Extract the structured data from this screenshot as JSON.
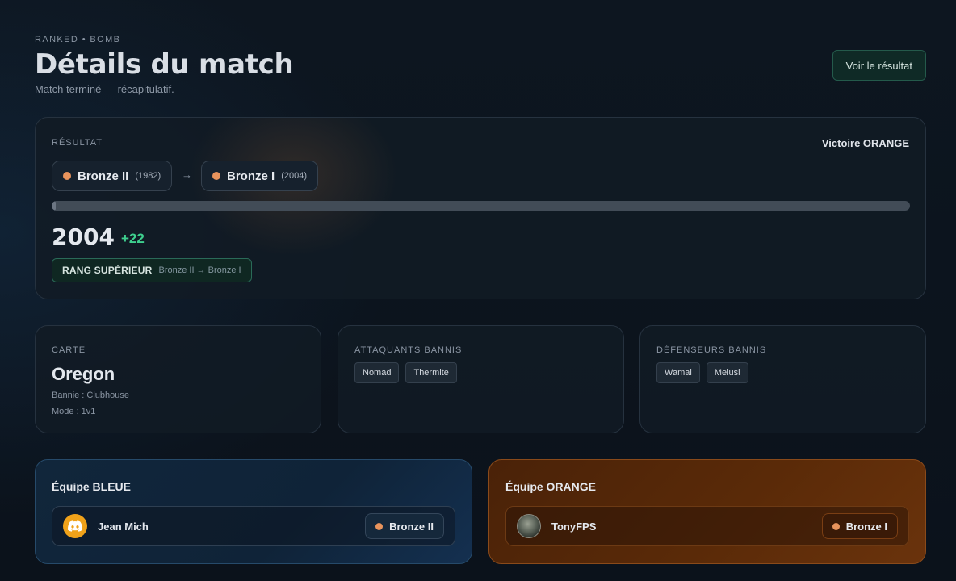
{
  "header": {
    "eyebrow": "RANKED • BOMB",
    "title": "Détails du match",
    "subtitle": "Match terminé — récapitulatif.",
    "result_button": "Voir le résultat"
  },
  "result": {
    "label": "RÉSULTAT",
    "outcome": "Victoire ORANGE",
    "from_rank": {
      "name": "Bronze II",
      "elo": "(1982)"
    },
    "arrow": "→",
    "to_rank": {
      "name": "Bronze I",
      "elo": "(2004)"
    },
    "progress_fraction": 0.005,
    "score": "2004",
    "delta": "+22",
    "promotion": {
      "title": "RANG SUPÉRIEUR",
      "detail": "Bronze II → Bronze I"
    }
  },
  "map": {
    "label": "CARTE",
    "name": "Oregon",
    "banned": "Bannie : Clubhouse",
    "mode": "Mode : 1v1"
  },
  "attackers_banned": {
    "label": "ATTAQUANTS BANNIS",
    "operators": [
      "Nomad",
      "Thermite"
    ]
  },
  "defenders_banned": {
    "label": "DÉFENSEURS BANNIS",
    "operators": [
      "Wamai",
      "Melusi"
    ]
  },
  "teams": {
    "blue": {
      "title": "Équipe BLEUE",
      "player": {
        "name": "Jean Mich",
        "rank": "Bronze II",
        "avatar": "discord-icon"
      }
    },
    "orange": {
      "title": "Équipe ORANGE",
      "player": {
        "name": "TonyFPS",
        "rank": "Bronze I",
        "avatar": "profile-photo"
      }
    }
  },
  "colors": {
    "accent_green": "#3ecf8e",
    "rank_bronze": "#e8935c",
    "team_blue": "#11263b",
    "team_orange": "#5a2a08"
  }
}
